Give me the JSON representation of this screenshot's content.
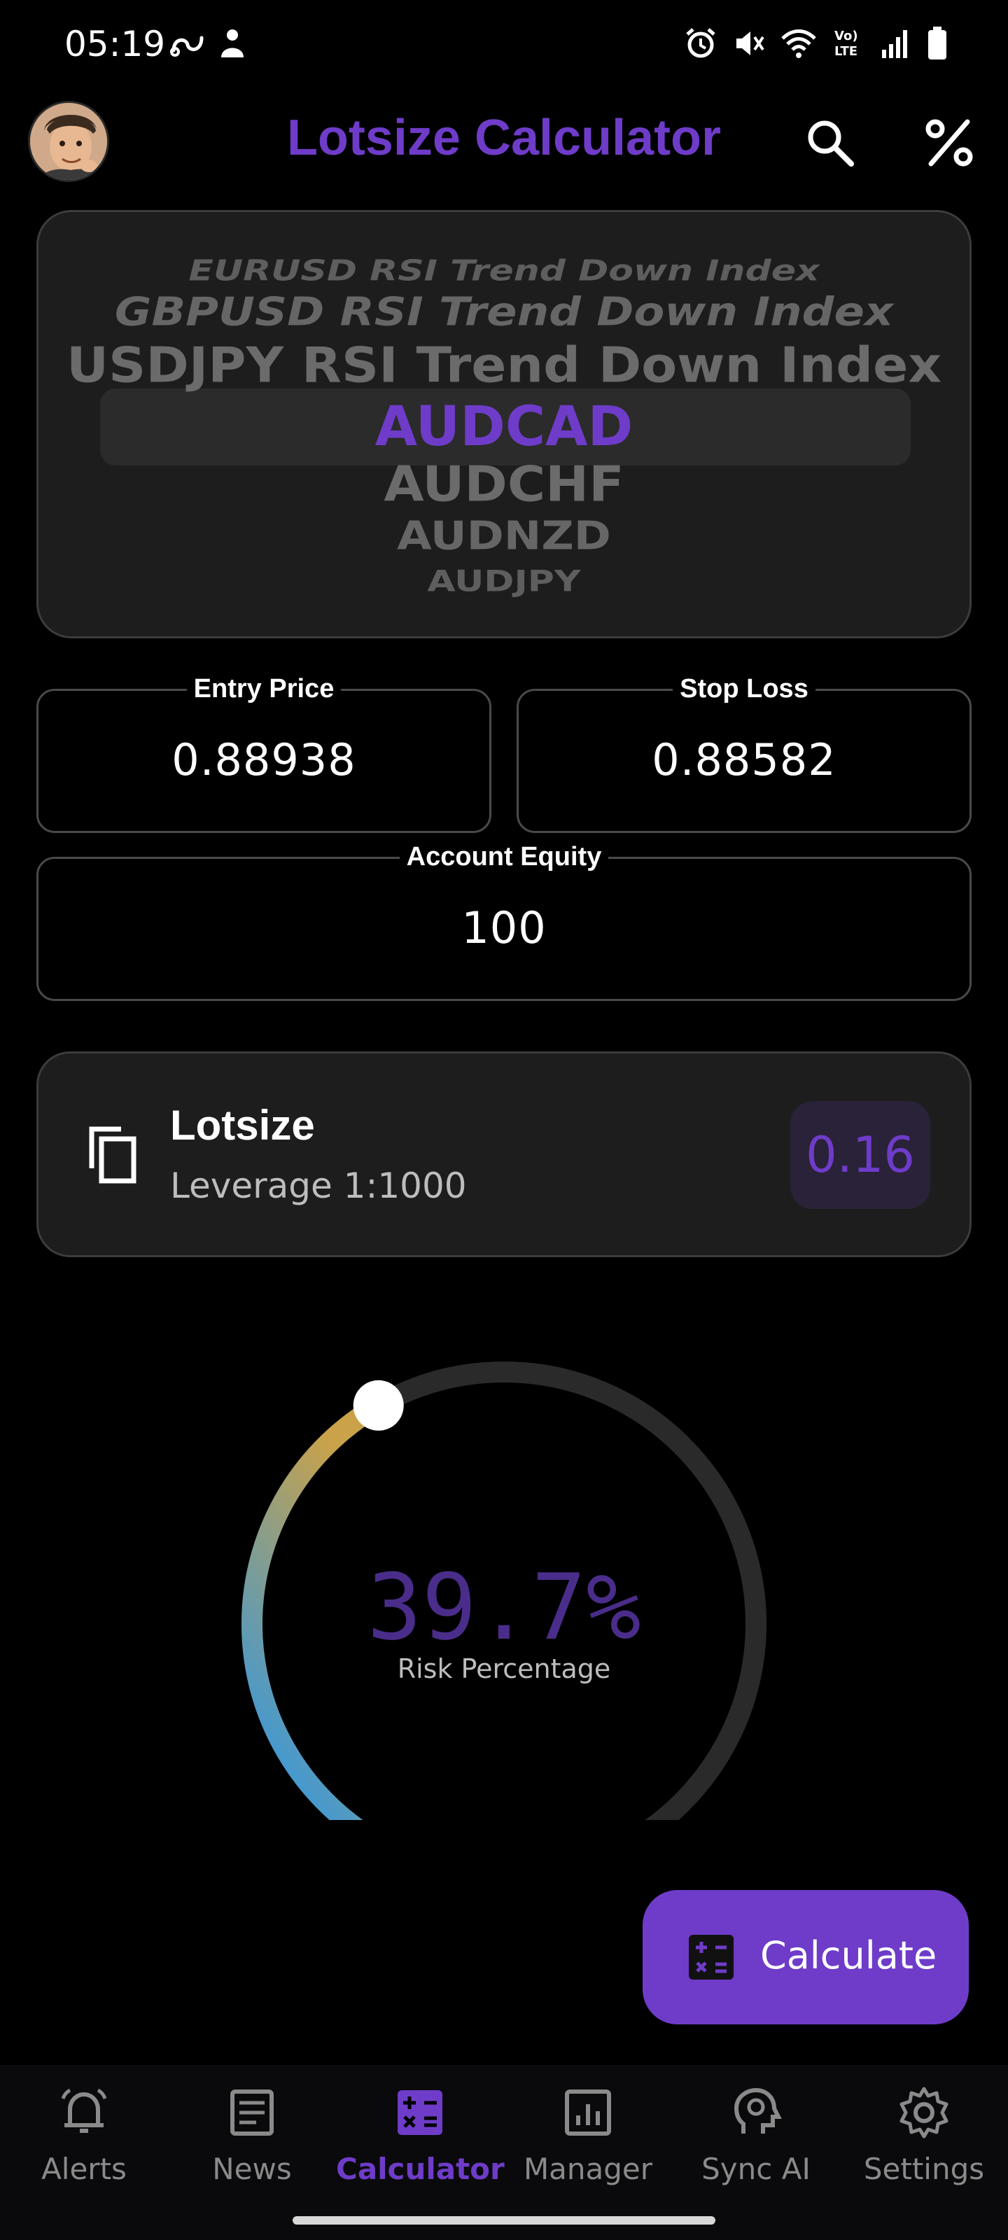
{
  "status_bar": {
    "time": "05:19",
    "left_icons": [
      "link-icon",
      "person-icon"
    ],
    "right_icons": [
      "alarm-icon",
      "mute-icon",
      "wifi-icon",
      "volte-icon",
      "signal-icon",
      "battery-icon"
    ],
    "volte_text": "Vo) LTE"
  },
  "app_bar": {
    "title": "Lotsize Calculator",
    "accent_color": "#6e3cc8",
    "icons": [
      "search-icon",
      "percent-icon"
    ]
  },
  "symbol_picker": {
    "items": [
      "EURUSD RSI Trend Down Index",
      "GBPUSD RSI Trend Down Index",
      "USDJPY RSI Trend Down Index",
      "AUDCAD",
      "AUDCHF",
      "AUDNZD",
      "AUDJPY"
    ],
    "selected": "AUDCAD"
  },
  "inputs": {
    "entry_price": {
      "label": "Entry Price",
      "value": "0.88938"
    },
    "stop_loss": {
      "label": "Stop Loss",
      "value": "0.88582"
    },
    "account_equity": {
      "label": "Account Equity",
      "value": "100"
    }
  },
  "lotsize_card": {
    "title": "Lotsize",
    "subtitle": "Leverage 1:1000",
    "value": "0.16",
    "icon": "copy-icon"
  },
  "risk_gauge": {
    "value_text": "39.7%",
    "value_percent": 39.7,
    "label": "Risk Percentage",
    "gradient_colors": [
      "#2196f3",
      "#c9a24a"
    ],
    "track_color": "#2a2a2a"
  },
  "fab": {
    "label": "Calculate",
    "icon": "calculator-icon"
  },
  "bottom_nav": {
    "items": [
      {
        "label": "Alerts",
        "icon": "bell-icon",
        "active": false
      },
      {
        "label": "News",
        "icon": "news-icon",
        "active": false
      },
      {
        "label": "Calculator",
        "icon": "calculator-icon",
        "active": true
      },
      {
        "label": "Manager",
        "icon": "chart-icon",
        "active": false
      },
      {
        "label": "Sync AI",
        "icon": "ai-head-icon",
        "active": false
      },
      {
        "label": "Settings",
        "icon": "gear-icon",
        "active": false
      }
    ]
  }
}
